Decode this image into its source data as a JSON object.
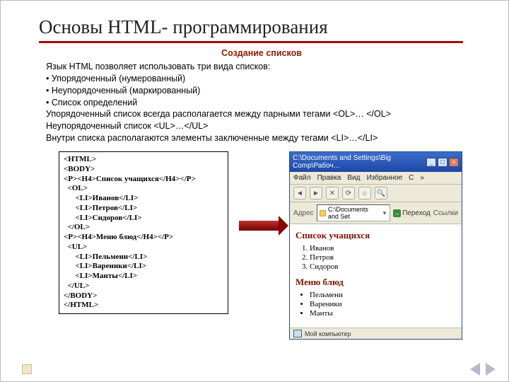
{
  "title": "Основы HTML- программирования",
  "subhead": "Создание списков",
  "intro": {
    "l1": "Язык HTML позволяет использовать три вида списков:",
    "b1": "• Упорядоченный (нумерованный)",
    "b2": "• Неупорядоченный (маркированный)",
    "b3": "• Список определений",
    "l2": "Упорядоченный список всегда располагается между парными тегами <OL>… </OL>",
    "l3": "Неупорядоченный список <UL>…</UL>",
    "l4": "Внутри списка располагаются элементы заключенные между тегами <LI>…</LI>"
  },
  "code": "<HTML>\n<BODY>\n<P><H4>Список учащихся</H4></P>\n  <OL>\n      <LI>Иванов</LI>\n      <LI>Петров</LI>\n      <LI>Сидоров</LI>\n  </OL>\n<P><H4>Меню блюд</H4></P>\n  <UL>\n      <LI>Пельмени</LI>\n      <LI>Вареники</LI>\n      <LI>Манты</LI>\n  </UL>\n</BODY>\n</HTML>",
  "browser": {
    "title": "C:\\Documents and Settings\\Big Comp\\Рабоч…",
    "menu": {
      "file": "Файл",
      "edit": "Правка",
      "view": "Вид",
      "fav": "Избранное",
      "tools": "С",
      "help": "»"
    },
    "addr_label": "Адрес",
    "addr_value": "C:\\Documents and Set",
    "go": "Переход",
    "links": "Ссылки",
    "page": {
      "h1": "Список учащихся",
      "ol": [
        "Иванов",
        "Петров",
        "Сидоров"
      ],
      "h2": "Меню блюд",
      "ul": [
        "Пельмени",
        "Вареники",
        "Манты"
      ]
    },
    "status": "Мой компьютер"
  }
}
